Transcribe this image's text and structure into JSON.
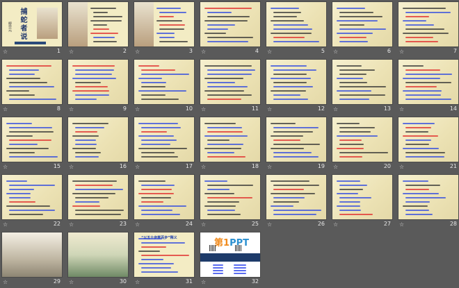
{
  "view": "slide-sorter",
  "colors": {
    "background": "#5a5a5a",
    "slide_bg": "#f3ecc4",
    "blue_text": "#1f3ee0",
    "red_text": "#e01f1f",
    "black_text": "#222222"
  },
  "title_slide": {
    "title": "捕蛇者说",
    "author": "柳宗元"
  },
  "slide31": {
    "heading": "“以五十步笑百步”释义"
  },
  "slide32": {
    "brand_prefix": "第",
    "brand_num": "1",
    "brand_suffix": "PPT"
  },
  "star_icon": "☆",
  "slides": [
    {
      "number": "1",
      "kind": "title"
    },
    {
      "number": "2",
      "kind": "picture-left"
    },
    {
      "number": "3",
      "kind": "picture-left2"
    },
    {
      "number": "4",
      "kind": "text"
    },
    {
      "number": "5",
      "kind": "text"
    },
    {
      "number": "6",
      "kind": "text"
    },
    {
      "number": "7",
      "kind": "text"
    },
    {
      "number": "8",
      "kind": "text"
    },
    {
      "number": "9",
      "kind": "text"
    },
    {
      "number": "10",
      "kind": "text"
    },
    {
      "number": "11",
      "kind": "text"
    },
    {
      "number": "12",
      "kind": "text"
    },
    {
      "number": "13",
      "kind": "text"
    },
    {
      "number": "14",
      "kind": "diagram"
    },
    {
      "number": "15",
      "kind": "text"
    },
    {
      "number": "16",
      "kind": "text"
    },
    {
      "number": "17",
      "kind": "text"
    },
    {
      "number": "18",
      "kind": "text"
    },
    {
      "number": "19",
      "kind": "text"
    },
    {
      "number": "20",
      "kind": "text"
    },
    {
      "number": "21",
      "kind": "text"
    },
    {
      "number": "22",
      "kind": "text"
    },
    {
      "number": "23",
      "kind": "text"
    },
    {
      "number": "24",
      "kind": "text"
    },
    {
      "number": "25",
      "kind": "text"
    },
    {
      "number": "26",
      "kind": "text"
    },
    {
      "number": "27",
      "kind": "text"
    },
    {
      "number": "28",
      "kind": "text"
    },
    {
      "number": "29",
      "kind": "landscape"
    },
    {
      "number": "30",
      "kind": "landscape2"
    },
    {
      "number": "31",
      "kind": "essay"
    },
    {
      "number": "32",
      "kind": "ad"
    }
  ]
}
